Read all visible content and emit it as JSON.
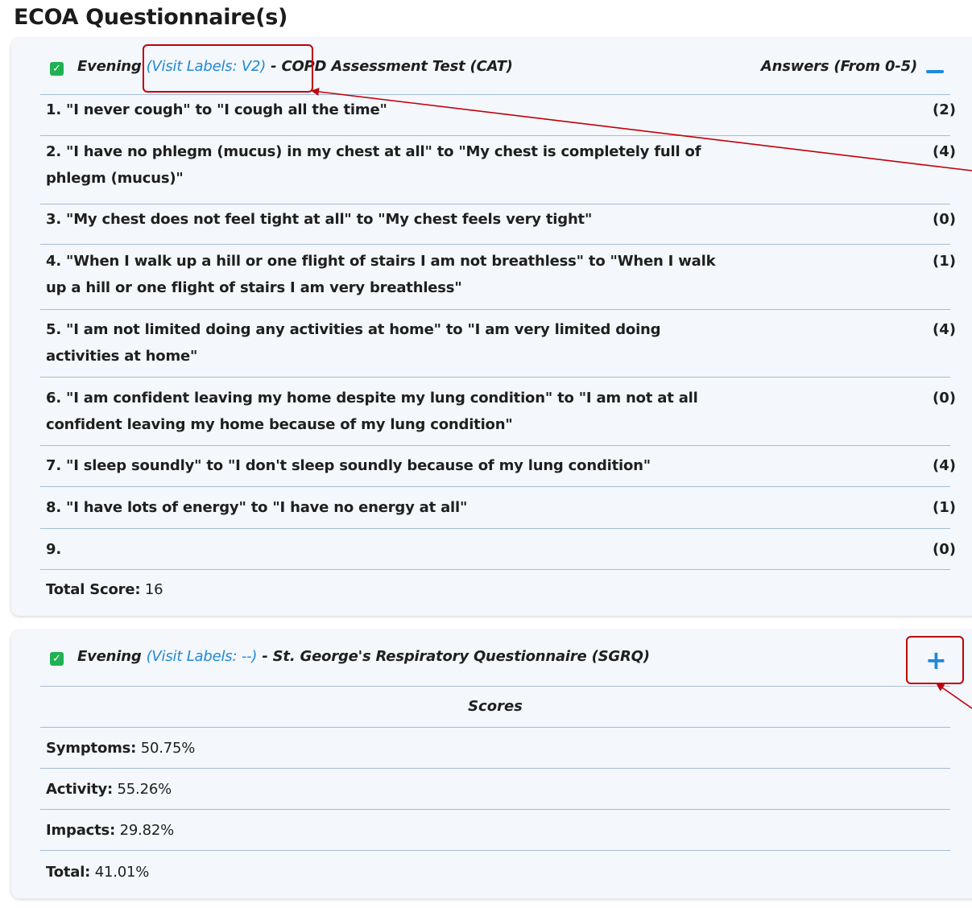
{
  "page": {
    "title": "ECOA Questionnaire(s)"
  },
  "cat": {
    "time": "Evening",
    "visit_labels": "(Visit Labels: V2)",
    "title": "- COPD Assessment Test (CAT)",
    "answers_label": "Answers (From 0-5)",
    "questions": [
      {
        "text": "1. \"I never cough\" to \"I cough all the time\"",
        "value": "(2)"
      },
      {
        "text": "2. \"I have no phlegm (mucus) in my chest at all\" to \"My chest is completely full of phlegm (mucus)\"",
        "value": "(4)"
      },
      {
        "text": "3. \"My chest does not feel tight at all\" to \"My chest feels very tight\"",
        "value": "(0)"
      },
      {
        "text": "4. \"When I walk up a hill or one flight of stairs I am not breathless\" to \"When I walk up a hill or one flight of stairs I am very breathless\"",
        "value": "(1)"
      },
      {
        "text": "5. \"I am not limited doing any activities at home\" to \"I am very limited doing activities at home\"",
        "value": "(4)"
      },
      {
        "text": "6. \"I am confident leaving my home despite my lung condition\" to \"I am not at all confident leaving my home because of my lung condition\"",
        "value": "(0)"
      },
      {
        "text": "7. \"I sleep soundly\" to \"I don't sleep soundly because of my lung condition\"",
        "value": "(4)"
      },
      {
        "text": "8. \"I have lots of energy\" to \"I have no energy at all\"",
        "value": "(1)"
      },
      {
        "text": "9.",
        "value": "(0)"
      }
    ],
    "total_label": "Total Score:",
    "total_value": "16"
  },
  "sgrq": {
    "time": "Evening",
    "visit_labels": "(Visit Labels: --)",
    "title": "- St. George's Respiratory Questionnaire (SGRQ)",
    "scores_label": "Scores",
    "scores": [
      {
        "label": "Symptoms:",
        "value": "50.75%"
      },
      {
        "label": "Activity:",
        "value": "55.26%"
      },
      {
        "label": "Impacts:",
        "value": "29.82%"
      },
      {
        "label": "Total:",
        "value": "41.01%"
      }
    ]
  },
  "colors": {
    "accent": "#1f88d8",
    "check": "#20b152",
    "annotation": "#c0000b",
    "divider": "#a6bcd4",
    "card": "#f4f7fb"
  },
  "icons": {
    "checkbox": "check-icon",
    "collapse": "minus-icon",
    "expand": "plus-icon"
  }
}
